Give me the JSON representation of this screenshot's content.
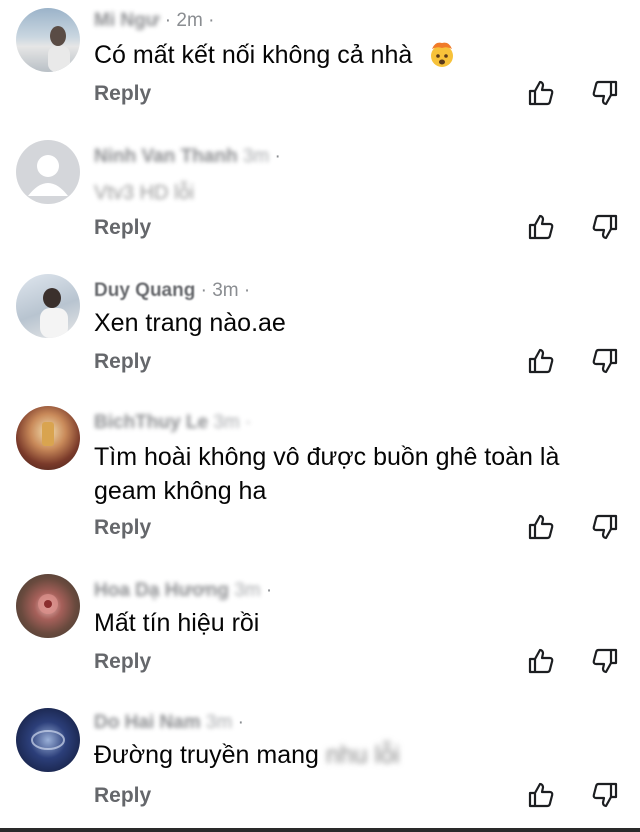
{
  "comments": [
    {
      "name": "Mi Ngư",
      "time": "2m",
      "text": "Có mất kết nối không cả nhà",
      "emoji": "exploding-head-emoji",
      "reply": "Reply",
      "avatar": "landscape-photo"
    },
    {
      "name": "Ninh Van Thanh",
      "time": "3m",
      "text": "Vtv3 HD lỗi",
      "reply": "Reply",
      "avatar": "default-avatar"
    },
    {
      "name": "Duy Quang",
      "time": "3m",
      "text": "Xen trang nào.ae",
      "reply": "Reply",
      "avatar": "person-photo"
    },
    {
      "name": "BichThuy Le",
      "time": "3m",
      "text": "Tìm hoài không vô được buồn ghê toàn là",
      "text2": "geam không ha",
      "reply": "Reply",
      "avatar": "warm-photo"
    },
    {
      "name": "Hoa Dạ Hương",
      "time": "3m",
      "text": "Mất tín hiệu rồi",
      "reply": "Reply",
      "avatar": "flower-photo"
    },
    {
      "name": "Do Hai Nam",
      "time": "3m",
      "text": "Đường truyền mang",
      "text_trail": "nhu lỗi",
      "reply": "Reply",
      "avatar": "dark-blue-photo"
    }
  ],
  "icons": {
    "like": "thumbs-up-icon",
    "dislike": "thumbs-down-icon"
  },
  "separator": "·"
}
